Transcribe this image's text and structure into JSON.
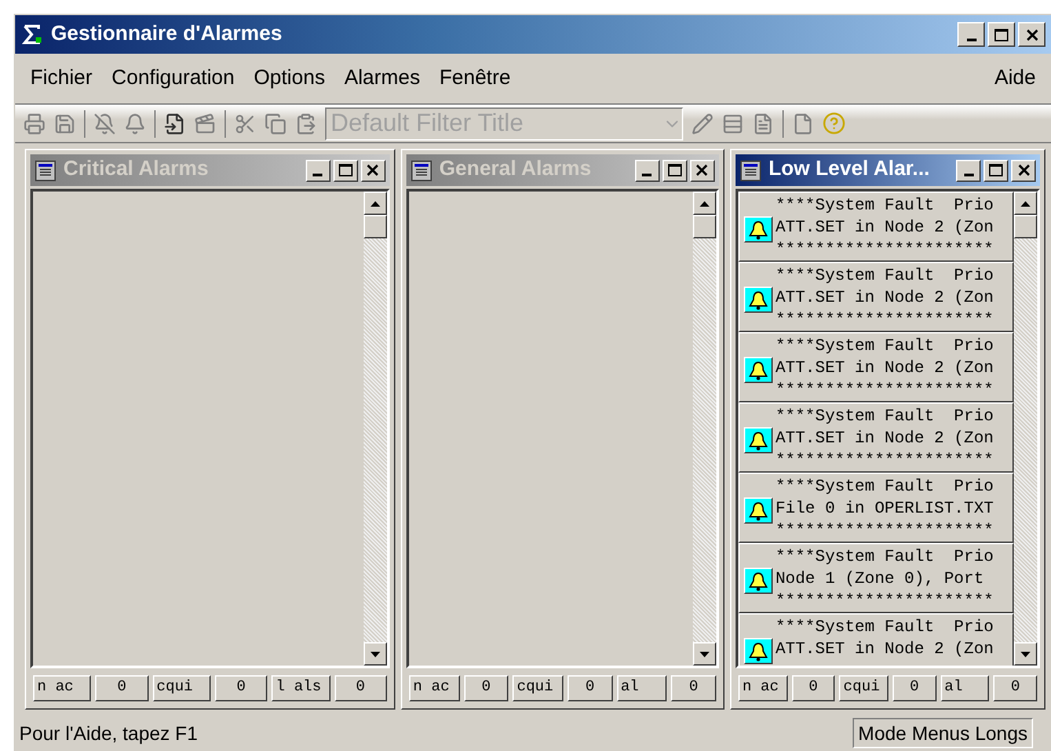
{
  "window": {
    "title": "Gestionnaire d'Alarmes"
  },
  "menu": {
    "items": [
      "Fichier",
      "Configuration",
      "Options",
      "Alarmes",
      "Fenêtre"
    ],
    "help": "Aide"
  },
  "toolbar": {
    "filter": {
      "value": "Default Filter Title",
      "disabled": true
    }
  },
  "child_windows": [
    {
      "title": "Critical Alarms",
      "active": false,
      "counters": [
        "n ac",
        "0",
        "cqui",
        "0",
        "l als",
        "0"
      ]
    },
    {
      "title": "General Alarms",
      "active": false,
      "counters": [
        "n ac",
        "0",
        "cqui",
        "0",
        "al",
        "0"
      ]
    },
    {
      "title": "Low Level Alar...",
      "active": true,
      "alarms": [
        {
          "lines": [
            "****System Fault  Prio",
            "ATT.SET in Node 2 (Zon",
            "**********************"
          ]
        },
        {
          "lines": [
            "****System Fault  Prio",
            "ATT.SET in Node 2 (Zon",
            "**********************"
          ]
        },
        {
          "lines": [
            "****System Fault  Prio",
            "ATT.SET in Node 2 (Zon",
            "**********************"
          ]
        },
        {
          "lines": [
            "****System Fault  Prio",
            "ATT.SET in Node 2 (Zon",
            "**********************"
          ]
        },
        {
          "lines": [
            "****System Fault  Prio",
            "File 0 in OPERLIST.TXT",
            "**********************"
          ]
        },
        {
          "lines": [
            "****System Fault  Prio",
            "Node 1 (Zone 0), Port ",
            "**********************"
          ]
        },
        {
          "lines": [
            "****System Fault  Prio",
            "ATT.SET in Node 2 (Zon"
          ]
        }
      ],
      "counters": [
        "n ac",
        "0",
        "cqui",
        "0",
        "al",
        "0"
      ]
    }
  ],
  "status_bar": {
    "message": "Pour l'Aide, tapez F1",
    "mode": "Mode Menus Longs"
  }
}
